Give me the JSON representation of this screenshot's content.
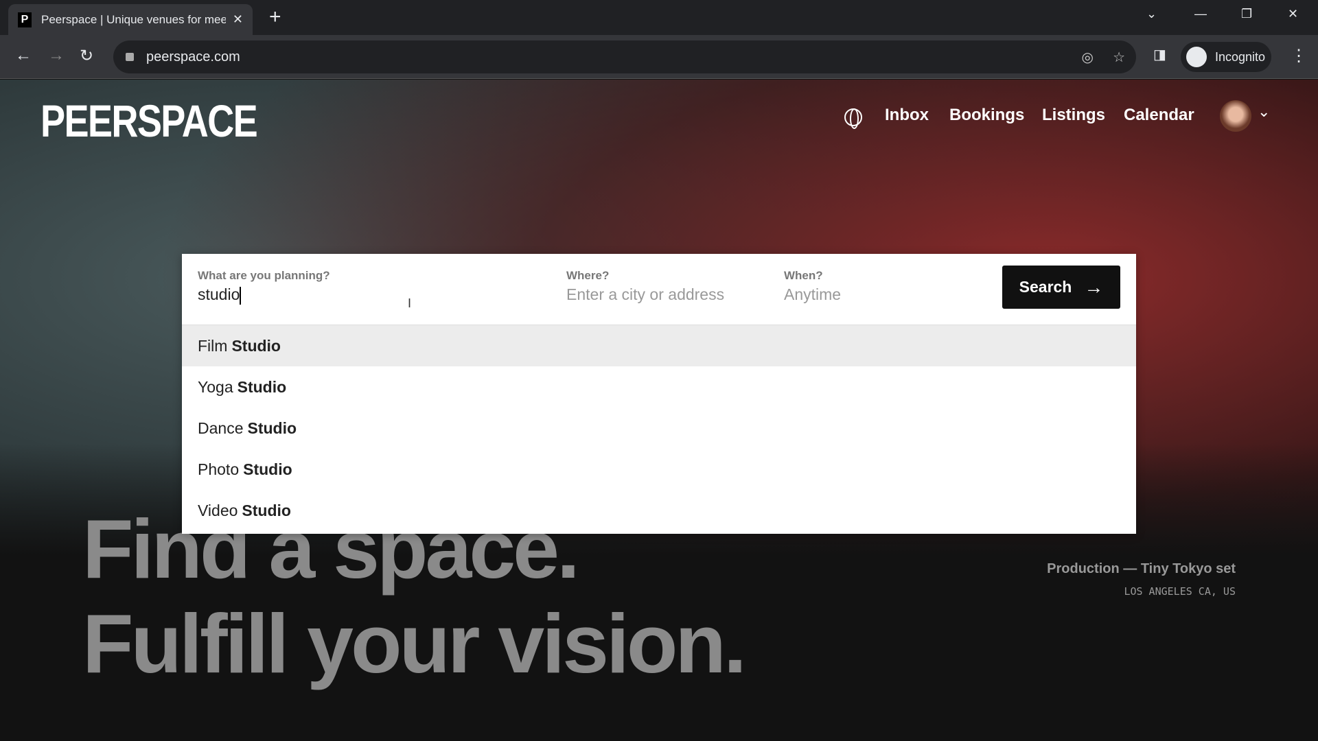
{
  "browser": {
    "tab_title": "Peerspace | Unique venues for meetings",
    "favicon": "P",
    "url": "peerspace.com",
    "profile": "Incognito"
  },
  "header": {
    "logo": "PEERSPACE",
    "nav": [
      "Inbox",
      "Bookings",
      "Listings",
      "Calendar"
    ]
  },
  "search": {
    "what_label": "What are you planning?",
    "what_value": "studio",
    "where_label": "Where?",
    "where_placeholder": "Enter a city or address",
    "when_label": "When?",
    "when_placeholder": "Anytime",
    "button": "Search",
    "suggestions": [
      {
        "prefix": "Film",
        "match": "Studio"
      },
      {
        "prefix": "Yoga",
        "match": "Studio"
      },
      {
        "prefix": "Dance",
        "match": "Studio"
      },
      {
        "prefix": "Photo",
        "match": "Studio"
      },
      {
        "prefix": "Video",
        "match": "Studio"
      }
    ]
  },
  "hero": {
    "line1": "Find a space.",
    "line2": "Fulfill your vision.",
    "caption": "Production — Tiny Tokyo set",
    "location": "LOS ANGELES CA, US"
  }
}
